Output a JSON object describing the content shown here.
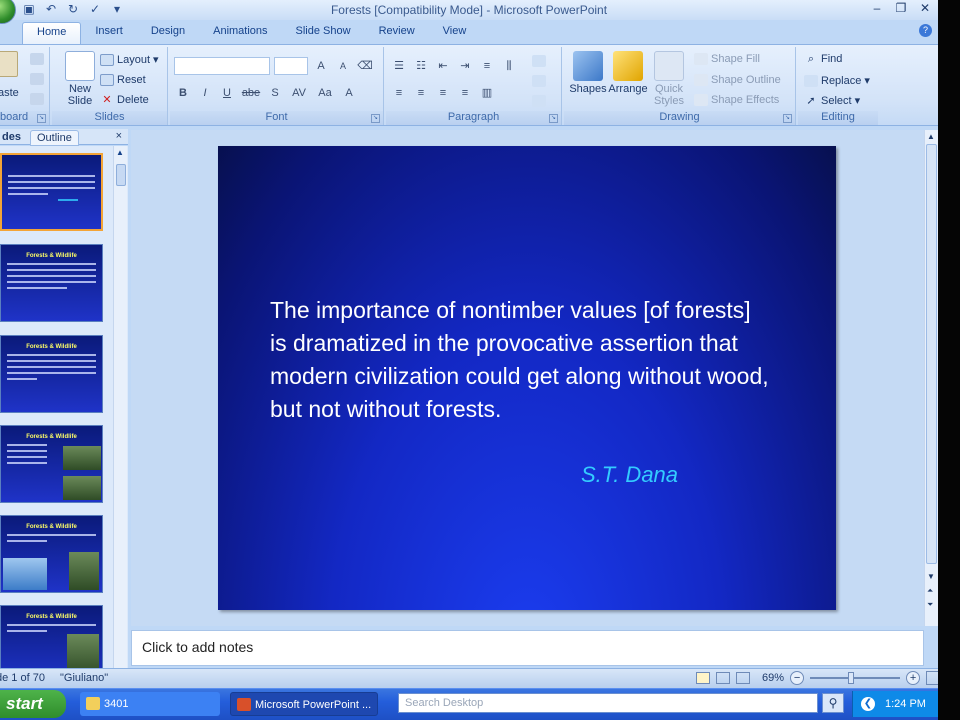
{
  "window": {
    "title": "Forests [Compatibility Mode] - Microsoft PowerPoint",
    "controls": {
      "minimize": "–",
      "restore": "❐",
      "close": "✕"
    }
  },
  "qat": {
    "save_icon": "save-icon",
    "undo_icon": "undo-icon",
    "redo_icon": "redo-icon",
    "customize_icon": "dropdown-icon"
  },
  "tabs": [
    "Home",
    "Insert",
    "Design",
    "Animations",
    "Slide Show",
    "Review",
    "View"
  ],
  "active_tab": "Home",
  "ribbon": {
    "clipboard": {
      "label": "board",
      "paste": "aste"
    },
    "slides": {
      "label": "Slides",
      "new_slide_1": "New",
      "new_slide_2": "Slide",
      "layout": "Layout",
      "reset": "Reset",
      "delete": "Delete"
    },
    "font": {
      "label": "Font",
      "bold": "B",
      "italic": "I",
      "underline": "U",
      "strike": "abe",
      "shadow": "S",
      "spacing": "AV",
      "case": "Aa",
      "color": "A",
      "grow": "A",
      "shrink": "A"
    },
    "paragraph": {
      "label": "Paragraph"
    },
    "drawing": {
      "label": "Drawing",
      "shapes": "Shapes",
      "arrange": "Arrange",
      "quick_styles_1": "Quick",
      "quick_styles_2": "Styles",
      "shape_fill": "Shape Fill",
      "shape_outline": "Shape Outline",
      "shape_effects": "Shape Effects"
    },
    "editing": {
      "label": "Editing",
      "find": "Find",
      "replace": "Replace",
      "select": "Select"
    }
  },
  "pane": {
    "tab_slides": "des",
    "tab_outline": "Outline",
    "close": "×",
    "thumbs": [
      {
        "title": "",
        "selected": true
      },
      {
        "title": "Forests & Wildlife"
      },
      {
        "title": "Forests & Wildlife"
      },
      {
        "title": "Forests & Wildlife"
      },
      {
        "title": "Forests & Wildlife"
      },
      {
        "title": "Forests & Wildlife"
      }
    ]
  },
  "slide": {
    "quote": "The importance of nontimber values [of forests] is dramatized in the provocative assertion that modern civilization could get along without wood, but not without forests.",
    "author": "S.T. Dana"
  },
  "notes": {
    "placeholder": "Click to add notes"
  },
  "status": {
    "slide_count": "de 1 of 70",
    "theme": "\"Giuliano\"",
    "zoom": "69%"
  },
  "taskbar": {
    "start": "start",
    "folder_task": "3401",
    "ppt_task": "Microsoft PowerPoint ...",
    "search_placeholder": "Search Desktop",
    "clock": "1:24 PM"
  }
}
